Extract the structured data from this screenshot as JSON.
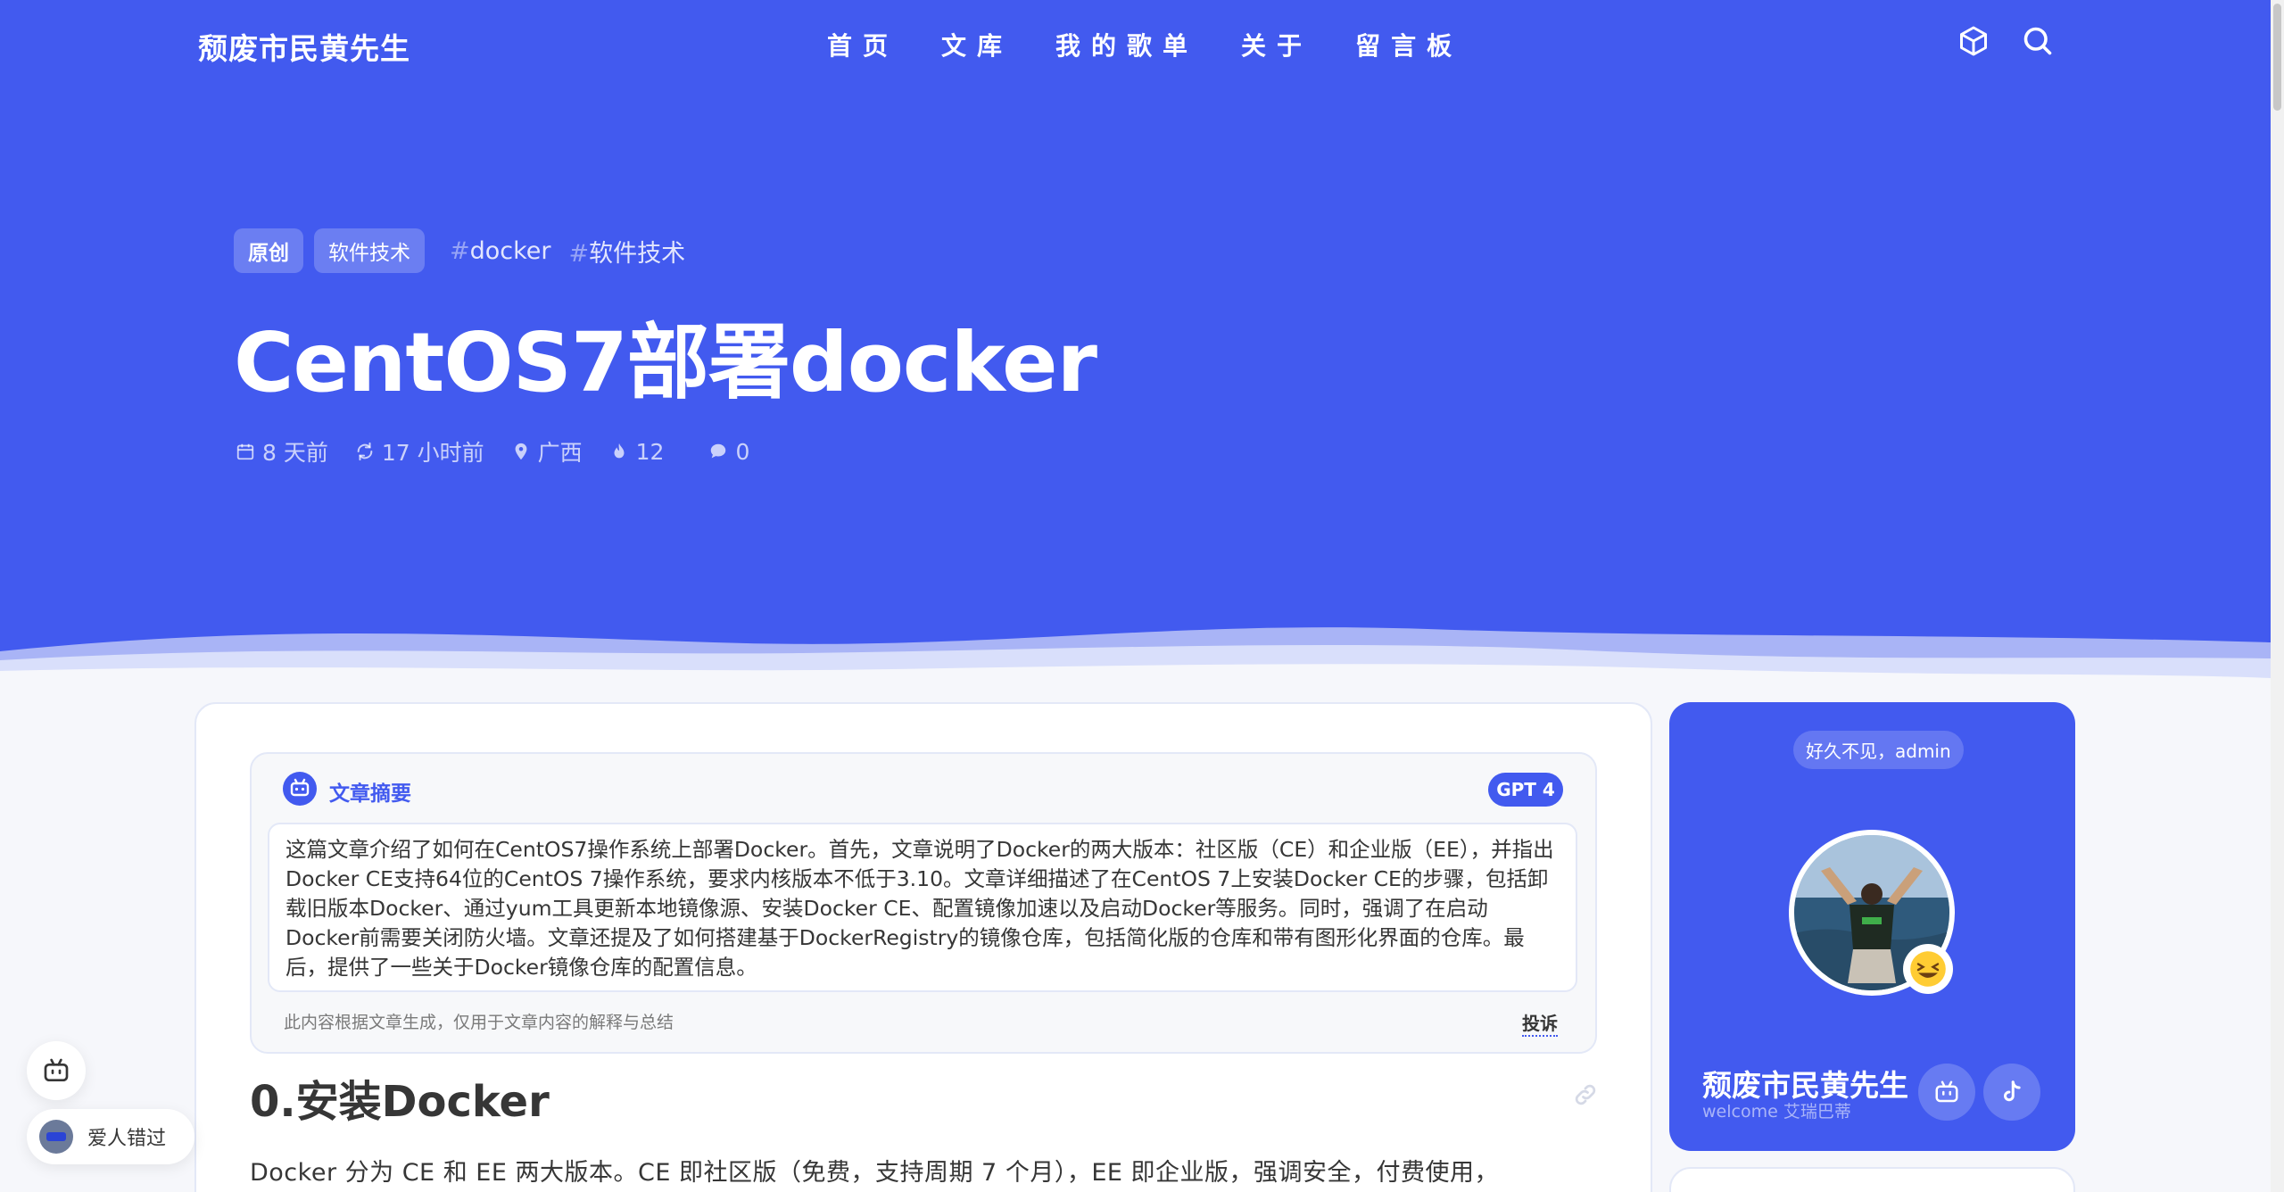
{
  "colors": {
    "brand": "#425aef",
    "page_background": "#f6f7fb",
    "card_background": "#ffffff",
    "text": "#363636"
  },
  "nav": {
    "logo": "颓废市民黄先生",
    "items": [
      "首页",
      "文库",
      "我的歌单",
      "关于",
      "留言板"
    ],
    "icons": [
      "cube-icon",
      "search-icon"
    ]
  },
  "post": {
    "badges": [
      "原创",
      "软件技术"
    ],
    "tags": [
      "docker",
      "软件技术"
    ],
    "title": "CentOS7部署docker",
    "meta": {
      "published": "8 天前",
      "updated": "17 小时前",
      "location": "广西",
      "views": "12",
      "comments": "0"
    }
  },
  "summary": {
    "title": "文章摘要",
    "badge": "GPT 4",
    "text": "这篇文章介绍了如何在CentOS7操作系统上部署Docker。首先，文章说明了Docker的两大版本：社区版（CE）和企业版（EE），并指出Docker CE支持64位的CentOS 7操作系统，要求内核版本不低于3.10。文章详细描述了在CentOS 7上安装Docker CE的步骤，包括卸载旧版本Docker、通过yum工具更新本地镜像源、安装Docker CE、配置镜像加速以及启动Docker等服务。同时，强调了在启动Docker前需要关闭防火墙。文章还提及了如何搭建基于DockerRegistry的镜像仓库，包括简化版的仓库和带有图形化界面的仓库。最后，提供了一些关于Docker镜像仓库的配置信息。",
    "note": "此内容根据文章生成，仅用于文章内容的解释与总结",
    "report": "投诉"
  },
  "article": {
    "heading": "0.安装Docker",
    "first_line": "Docker 分为 CE 和 EE 两大版本。CE 即社区版（免费，支持周期 7 个月），EE 即企业版，强调安全，付费使用，"
  },
  "profile": {
    "greeting": "好久不见，admin",
    "name": "颓废市民黄先生",
    "welcome": "welcome 艾瑞巴蒂"
  },
  "floating": {
    "music_title": "爱人错过"
  }
}
